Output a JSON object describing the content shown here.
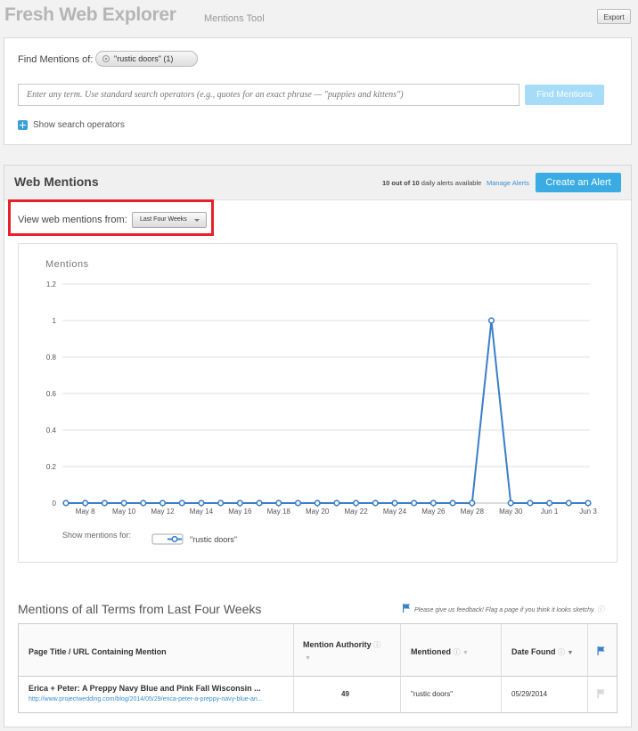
{
  "header": {
    "app_title": "Fresh Web Explorer",
    "app_subtitle": "Mentions Tool",
    "export_label": "Export"
  },
  "search": {
    "find_label": "Find Mentions of:",
    "term_chip": "\"rustic doors\" (1)",
    "placeholder": "Enter any term. Use standard search operators (e.g., quotes for an exact phrase — \"puppies and kittens\")",
    "find_button": "Find Mentions",
    "show_operators": "Show search operators"
  },
  "mentions": {
    "title": "Web Mentions",
    "alerts_used": "10 out of 10",
    "alerts_suffix": " daily alerts available",
    "manage_alerts": "Manage Alerts",
    "create_alert": "Create an Alert",
    "view_label": "View web mentions from:",
    "range_value": "Last Four Weeks"
  },
  "chart_data": {
    "type": "line",
    "title": "Mentions",
    "ylim": [
      0,
      1.2
    ],
    "y_ticks": [
      "0",
      "0.2",
      "0.4",
      "0.6",
      "0.8",
      "1",
      "1.2"
    ],
    "x_tick_labels": [
      "May 8",
      "May 10",
      "May 12",
      "May 14",
      "May 16",
      "May 18",
      "May 20",
      "May 22",
      "May 24",
      "May 26",
      "May 28",
      "May 30",
      "Jun 1",
      "Jun 3"
    ],
    "x": [
      "May 7",
      "May 8",
      "May 9",
      "May 10",
      "May 11",
      "May 12",
      "May 13",
      "May 14",
      "May 15",
      "May 16",
      "May 17",
      "May 18",
      "May 19",
      "May 20",
      "May 21",
      "May 22",
      "May 23",
      "May 24",
      "May 25",
      "May 26",
      "May 27",
      "May 28",
      "May 29",
      "May 30",
      "May 31",
      "Jun 1",
      "Jun 2",
      "Jun 3"
    ],
    "series": [
      {
        "name": "\"rustic doors\"",
        "color": "#3a7fc8",
        "values": [
          0,
          0,
          0,
          0,
          0,
          0,
          0,
          0,
          0,
          0,
          0,
          0,
          0,
          0,
          0,
          0,
          0,
          0,
          0,
          0,
          0,
          0,
          1,
          0,
          0,
          0,
          0,
          0
        ]
      }
    ],
    "legend_label": "Show mentions for:",
    "grid": true
  },
  "table": {
    "section_title": "Mentions of all Terms from Last Four Weeks",
    "feedback": "Please give us feedback! Flag a page if you think it looks sketchy.",
    "columns": [
      "Page Title / URL Containing Mention",
      "Mention Authority",
      "Mentioned",
      "Date Found"
    ],
    "rows": [
      {
        "title": "Erica + Peter: A Preppy Navy Blue and Pink Fall Wisconsin ...",
        "url": "http://www.projectwedding.com/blog/2014/05/29/erica-peter-a-preppy-navy-blue-an...",
        "authority": "49",
        "mentioned": "\"rustic doors\"",
        "date": "05/29/2014"
      }
    ]
  }
}
